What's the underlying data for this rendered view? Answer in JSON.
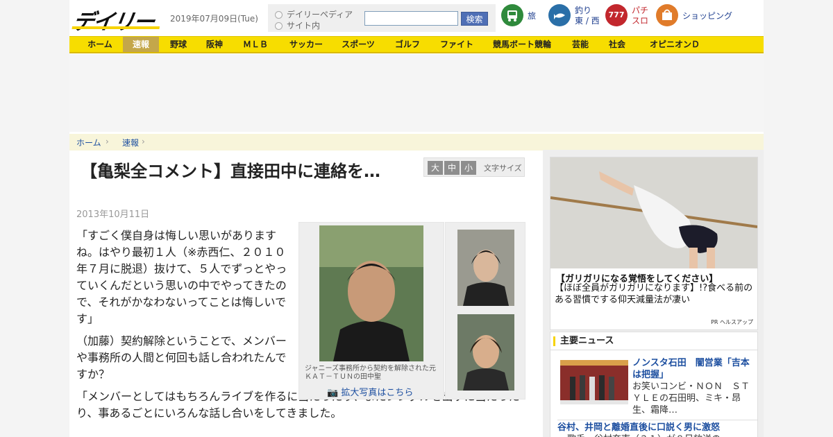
{
  "header": {
    "logo_text": "デイリー",
    "date": "2019年07月09日(Tue)",
    "search": {
      "option_1": "デイリーペディア",
      "option_2": "サイト内",
      "input_value": "",
      "button_label": "検索"
    },
    "top_links": [
      {
        "icon": "bus-icon",
        "label": "旅"
      },
      {
        "icon": "fishing-icon",
        "label_1": "釣り",
        "label_2": "東 / 西"
      },
      {
        "icon": "slot-icon",
        "label_1": "パチ",
        "label_2": "スロ",
        "icon_text": "777"
      },
      {
        "icon": "shopping-icon",
        "label": "ショッピング"
      }
    ]
  },
  "nav": {
    "items": [
      "ホーム",
      "速報",
      "野球",
      "阪神",
      "ＭＬＢ",
      "サッカー",
      "スポーツ",
      "ゴルフ",
      "ファイト",
      "競馬ボート競輪",
      "芸能",
      "社会",
      "オピニオンＤ"
    ],
    "active_index": 1
  },
  "breadcrumb": [
    "ホーム",
    "速報"
  ],
  "article": {
    "title": "【亀梨全コメント】直接田中に連絡を…",
    "date": "2013年10月11日",
    "font_size_labels": [
      "大",
      "中",
      "小"
    ],
    "font_size_caption": "文字サイズ",
    "paragraphs": [
      "「すごく僕自身は悔しい思いがありますね。はやり最初１人（※赤西仁、２０１０年７月に脱退）抜けて、５人でずっとやっていくんだという思いの中でやってきたので、それがかなわないってことは悔しいです」",
      "（加藤）契約解除ということで、メンバーや事務所の人間と何回も話し合われたんですか？",
      "「メンバーとしてはもちろんライブを作るに当たったり、またシングルを出すに当たったり、事あるごとにいろんな話し合いをしてきました。"
    ],
    "photo_caption": "ジャニーズ事務所から契約を解除された元ＫＡＴ－ＴＵＮの田中聖",
    "enlarge_label": "拡大写真はこちら"
  },
  "sidebar": {
    "pr": {
      "headline": "【ガリガリになる覚悟をしてください】",
      "text": "【ほぼ全員がガリガリになります】!?食べる前のある習慣でする仰天減量法が凄い",
      "sponsor": "PR ヘルスアップ"
    },
    "news": {
      "heading": "主要ニュース",
      "items": [
        {
          "title": "ノンスタ石田　闇営業「吉本は把握」",
          "snippet": "お笑いコンビ・ＮＯＮ　ＳＴＹＬＥの石田明、ミキ・昂生、霜降…"
        },
        {
          "title": "谷村、井岡と離婚直後に口説く男に激怒",
          "snippet": "歌手・谷村奈南（３１）が８日放送の"
        }
      ]
    }
  },
  "colors": {
    "nav_yellow": "#f7dd00",
    "nav_active": "#c4a74a",
    "link_blue": "#1d4fa0"
  }
}
